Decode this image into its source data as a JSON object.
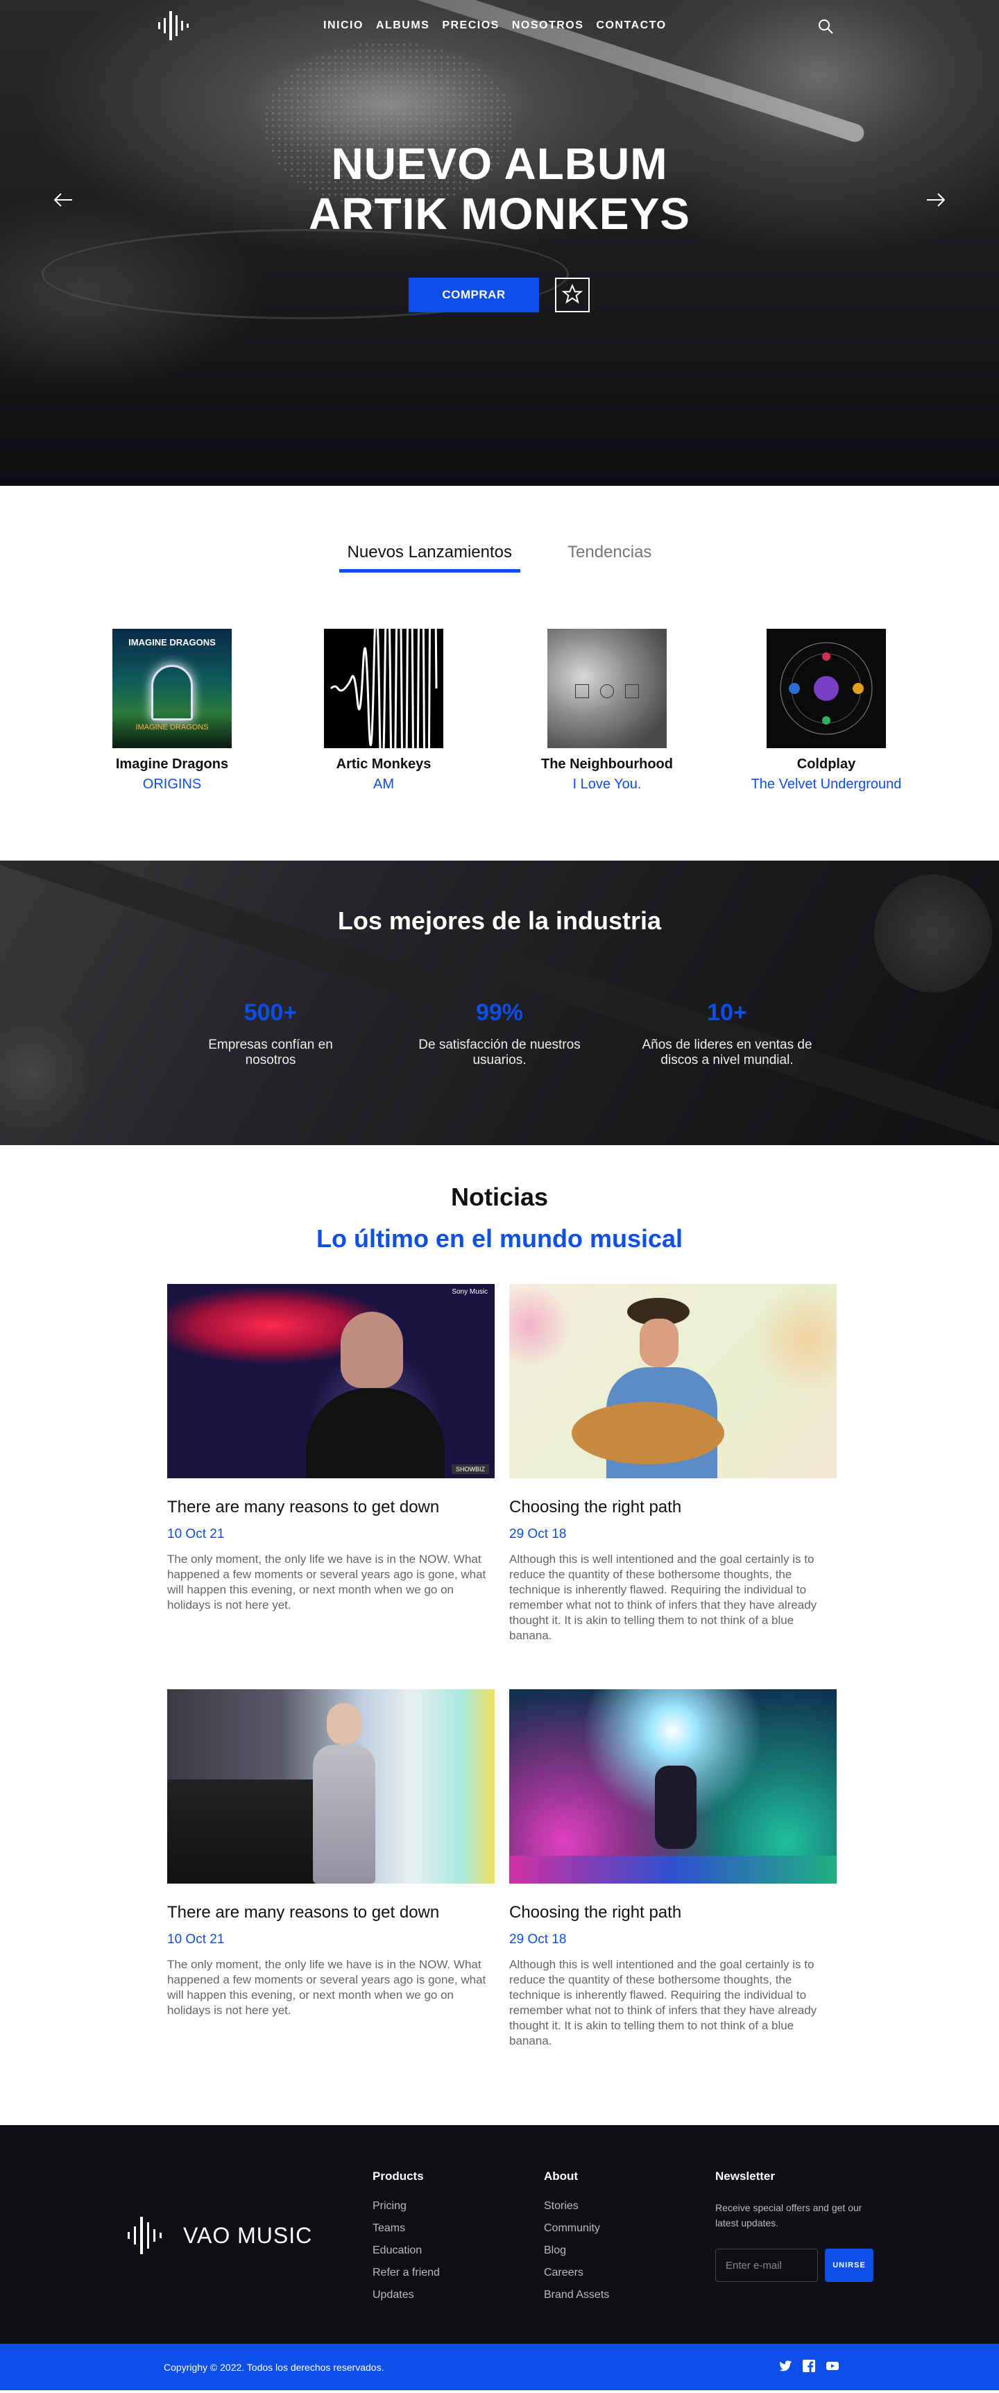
{
  "nav": {
    "items": [
      "INICIO",
      "ALBUMS",
      "PRECIOS",
      "NOSOTROS",
      "CONTACTO"
    ],
    "search_icon": "search-icon"
  },
  "hero": {
    "title_line1": "NUEVO ALBUM",
    "title_line2": "ARTIK MONKEYS",
    "buy_label": "COMPRAR",
    "favorite_icon": "star-icon",
    "prev_icon": "arrow-left-icon",
    "next_icon": "arrow-right-icon"
  },
  "releases": {
    "tabs": [
      "Nuevos Lanzamientos",
      "Tendencias"
    ],
    "active_tab": "Nuevos Lanzamientos",
    "albums": [
      {
        "artist": "Imagine Dragons",
        "title": "ORIGINS"
      },
      {
        "artist": "Artic Monkeys",
        "title": "AM"
      },
      {
        "artist": "The Neighbourhood",
        "title": "I Love You."
      },
      {
        "artist": "Coldplay",
        "title": "The Velvet Underground"
      }
    ],
    "cover_text": {
      "album1_band": "IMAGINE DRAGONS",
      "album1_sub": "IMAGINE DRAGONS"
    }
  },
  "stats": {
    "heading": "Los mejores de la industria",
    "items": [
      {
        "value": "500+",
        "desc_l1": "Empresas confían en",
        "desc_l2": "nosotros"
      },
      {
        "value": "99%",
        "desc_l1": "De satisfacción de nuestros",
        "desc_l2": "usuarios."
      },
      {
        "value": "10+",
        "desc_l1": "Años de lideres en ventas de",
        "desc_l2": "discos a nivel mundial."
      }
    ]
  },
  "news": {
    "heading": "Noticias",
    "subheading": "Lo último en el mundo musical",
    "cards": [
      {
        "title": "There are many reasons to get down",
        "date": "10 Oct 21",
        "text": "The only moment, the only life we have is in the NOW. What happened a few moments or several years ago is gone, what will happen this evening, or next month when we go on holidays is not here yet.",
        "img_tag_top": "Sony Music",
        "img_tag_bottom": "SHOWBIZ"
      },
      {
        "title": "Choosing the right path",
        "date": "29 Oct 18",
        "text": "Although this is well intentioned and the goal certainly is to reduce the quantity of these bothersome thoughts, the technique is inherently flawed. Requiring the individual to remember what not to think of infers that they have already thought it. It is akin to telling them to not think of a blue banana."
      },
      {
        "title": "There are many reasons to get down",
        "date": "10 Oct 21",
        "text": "The only moment, the only life we have is in the NOW. What happened a few moments or several years ago is gone, what will happen this evening, or next month when we go on holidays is not here yet."
      },
      {
        "title": "Choosing the right path",
        "date": "29 Oct 18",
        "text": "Although this is well intentioned and the goal certainly is to reduce the quantity of these bothersome thoughts, the technique is inherently flawed. Requiring the individual to remember what not to think of infers that they have already thought it. It is akin to telling them to not think of a blue banana."
      }
    ]
  },
  "footer": {
    "brand": "VAO MUSIC",
    "products": {
      "heading": "Products",
      "links": [
        "Pricing",
        "Teams",
        "Education",
        "Refer a friend",
        "Updates"
      ]
    },
    "about": {
      "heading": "About",
      "links": [
        "Stories",
        "Community",
        "Blog",
        "Careers",
        "Brand Assets"
      ]
    },
    "newsletter": {
      "heading": "Newsletter",
      "desc": "Receive special offers and  get our latest updates.",
      "placeholder": "Enter e-mail",
      "button": "UNIRSE"
    },
    "copyright": "Copyrighy © 2022. Todos los derechos reservados.",
    "social_icons": [
      "twitter-icon",
      "facebook-icon",
      "youtube-icon"
    ]
  },
  "colors": {
    "accent": "#0d4fe8",
    "dark": "#0e0f14",
    "muted": "#666666"
  }
}
